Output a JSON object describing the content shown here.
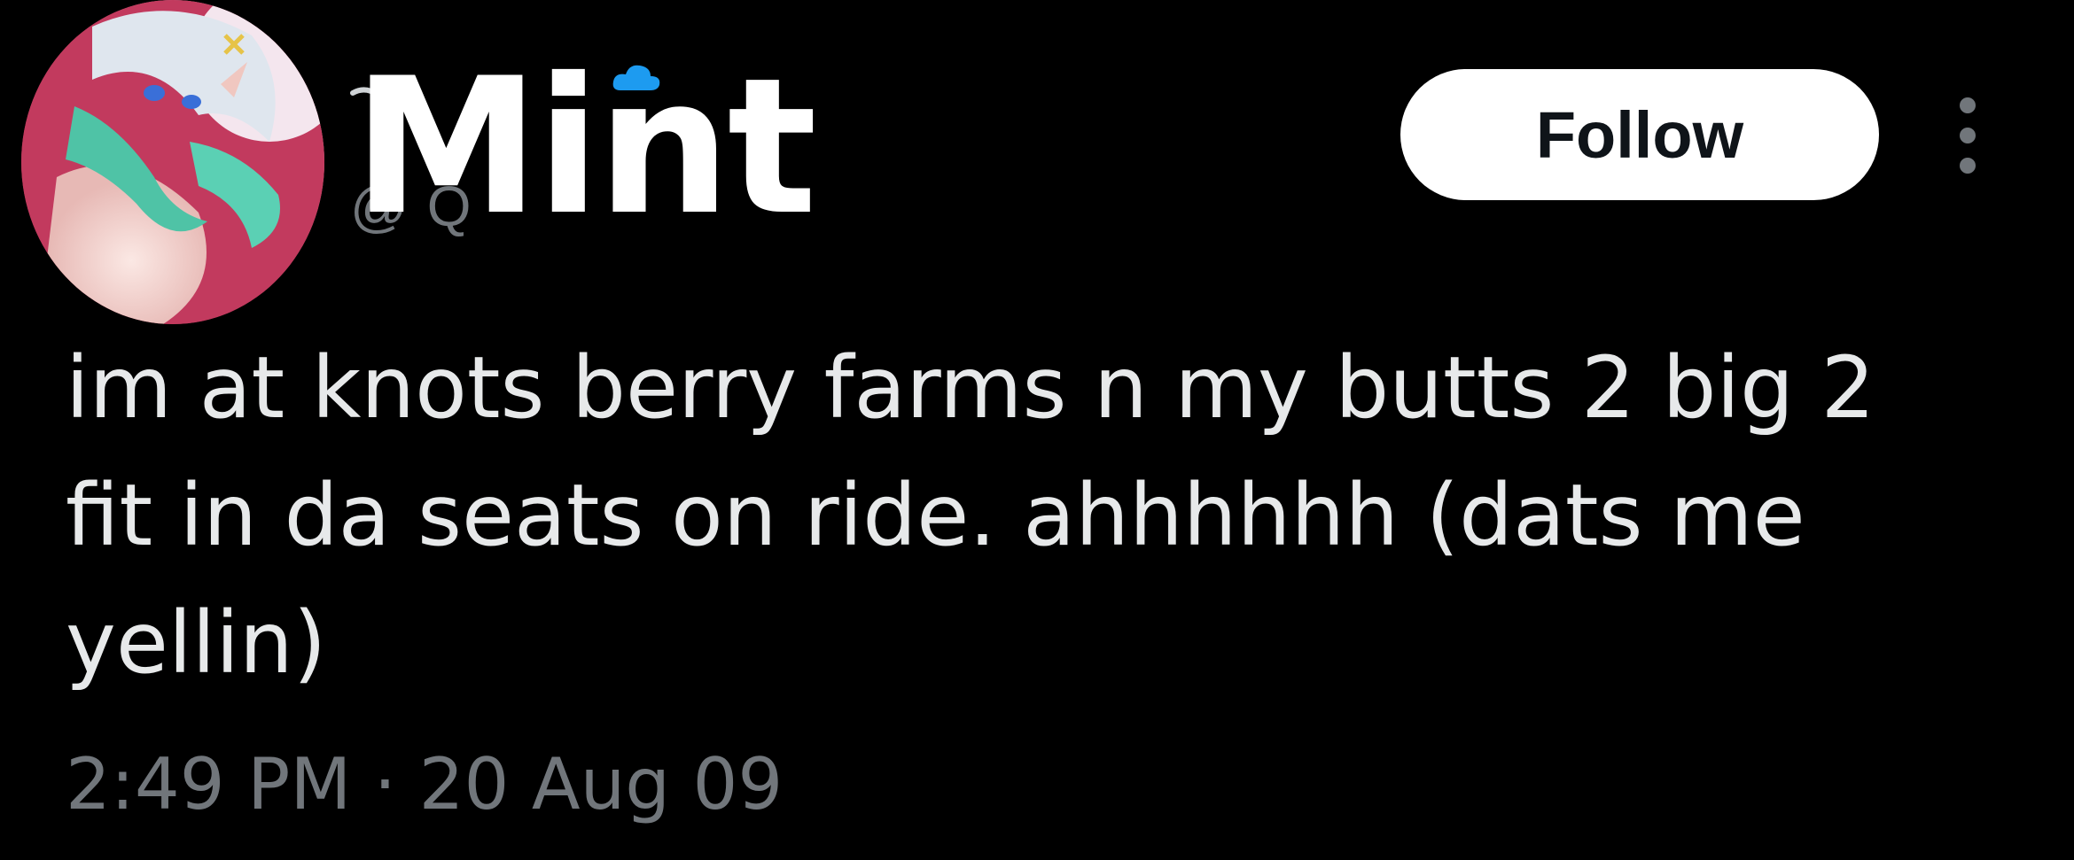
{
  "tweet": {
    "display_name": "Mint",
    "handle_partial": "@    Q",
    "follow_label": "Follow",
    "more_icon": "more-vertical-icon",
    "text": "im at knots berry farms n my butts 2 big 2\nfit in da seats on ride. ahhhhhh (dats me\nyellin)",
    "time": "2:49 PM",
    "separator": " · ",
    "date": "20 Aug 09"
  },
  "colors": {
    "background": "#000000",
    "text_primary": "#e7e9ea",
    "text_secondary": "#71767b",
    "button_bg": "#ffffff",
    "button_text": "#0f1419",
    "cloud_accent": "#1d9bf0"
  }
}
